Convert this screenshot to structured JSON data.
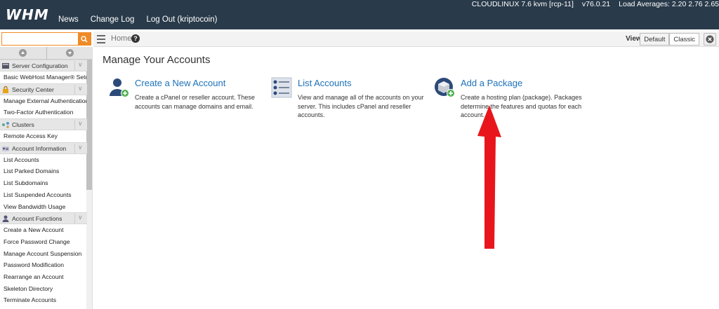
{
  "header": {
    "logo": "WHM",
    "nav": [
      "News",
      "Change Log",
      "Log Out (kriptocoin)"
    ],
    "os": "CLOUDLINUX 7.6 kvm [rcp-11]",
    "version": "v76.0.21",
    "load": "Load Averages: 2.20 2.76 2.65"
  },
  "search": {
    "value": "",
    "placeholder": ""
  },
  "breadcrumb": {
    "home": "Home"
  },
  "view": {
    "label": "View:",
    "options": [
      "Default",
      "Classic"
    ],
    "selected": "Default"
  },
  "sidebar": {
    "sections": [
      {
        "title": "Server Configuration",
        "icon": "server-icon",
        "items": [
          "Basic WebHost Manager® Setup"
        ]
      },
      {
        "title": "Security Center",
        "icon": "lock-icon",
        "items": [
          "Manage External Authentications",
          "Two-Factor Authentication"
        ]
      },
      {
        "title": "Clusters",
        "icon": "cluster-icon",
        "items": [
          "Remote Access Key"
        ]
      },
      {
        "title": "Account Information",
        "icon": "account-list-icon",
        "items": [
          "List Accounts",
          "List Parked Domains",
          "List Subdomains",
          "List Suspended Accounts",
          "View Bandwidth Usage"
        ]
      },
      {
        "title": "Account Functions",
        "icon": "user-icon",
        "items": [
          "Create a New Account",
          "Force Password Change",
          "Manage Account Suspension",
          "Password Modification",
          "Rearrange an Account",
          "Skeleton Directory",
          "Terminate Accounts"
        ]
      }
    ]
  },
  "main": {
    "title": "Manage Your Accounts",
    "cards": [
      {
        "title": "Create a New Account",
        "desc": "Create a cPanel or reseller account. These accounts can manage domains and email.",
        "icon": "add-user-icon"
      },
      {
        "title": "List Accounts",
        "desc": "View and manage all of the accounts on your server. This includes cPanel and reseller accounts.",
        "icon": "list-accounts-icon"
      },
      {
        "title": "Add a Package",
        "desc": "Create a hosting plan (package). Packages determine the features and quotas for each account.",
        "icon": "add-package-icon"
      }
    ]
  },
  "colors": {
    "header_bg": "#293a4a",
    "link": "#1d71b8",
    "search_accent": "#f08a24",
    "annotation": "#e8161c"
  }
}
